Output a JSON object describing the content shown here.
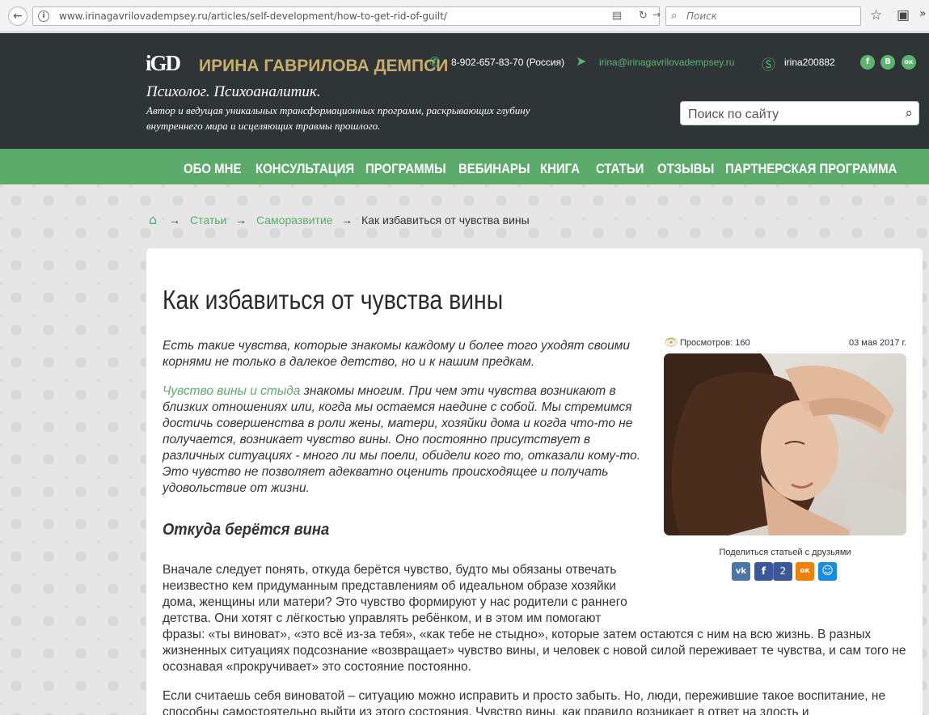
{
  "browser": {
    "back_icon": "back-arrow-icon",
    "url": "www.irinagavrilovadempsey.ru/articles/self-development/how-to-get-rid-of-guilt/",
    "search_placeholder": "Поиск"
  },
  "site": {
    "logo_mark": "iGD",
    "name": "ИРИНА ГАВРИЛОВА ДЕМПСИ",
    "tagline": "Психолог. Психоаналитик.",
    "description": "Автор и ведущая уникальных трансформационных программ, раскрывающих глубину внутреннего мира и исцеляющих травмы прошлого.",
    "phone": "8-902-657-83-70 (Россия)",
    "email": "irina@irinagavrilovadempsey.ru",
    "skype": "irina200882",
    "social": [
      {
        "icon": "facebook-icon",
        "glyph": "f"
      },
      {
        "icon": "vk-icon",
        "glyph": "В"
      },
      {
        "icon": "odnoklassniki-icon",
        "glyph": "ок"
      }
    ],
    "search_placeholder": "Поиск по сайту",
    "colors": {
      "header": "#2f3537",
      "accent": "#5cab6b",
      "gold": "#c9ad6a"
    }
  },
  "nav": [
    "ОБО МНЕ",
    "КОНСУЛЬТАЦИЯ",
    "ПРОГРАММЫ",
    "ВЕБИНАРЫ",
    "КНИГА",
    "СТАТЬИ",
    "ОТЗЫВЫ",
    "ПАРТНЕРСКАЯ ПРОГРАММА"
  ],
  "breadcrumb": {
    "sep": "→",
    "items": [
      "Статьи",
      "Саморазвитие"
    ],
    "current": "Как избавиться от чувства вины"
  },
  "article": {
    "title": "Как избавиться от чувства вины",
    "intro": "Есть такие чувства, которые знакомы каждому и более того уходят своими корнями не только в далекое детство, но и к нашим предкам.",
    "p2_link": "Чувство вины и стыда",
    "p2_text": " знакомы многим. При чем эти чувства возникают в близких отношениях или, когда мы остаемся наедине с собой. Мы стремимся достичь совершенства в роли жены, матери, хозяйки дома и когда что-то не получается, возникает чувство вины. Оно постоянно присутствует в различных ситуациях - много ли мы поели, обидели кого то, отказали кому-то. Это чувство не позволяет адекватно оценить происходящее и получать удовольствие от жизни.",
    "heading": "Откуда берётся вина",
    "p3a": "Вначале следует понять, откуда берётся чувство, будто мы обязаны отвечать неизвестно кем придуманным представлениям об идеальном образе хозяйки дома, женщины или матери? Это чувство формируют у нас родители с раннего детства. Они хотят с лёгкостью управлять ребёнком, и в этом им помогают",
    "p3b": "фразы: «ты виноват», «это всё из-за тебя», «как тебе не стыдно», которые затем остаются с ним на всю жизнь. В разных жизненных ситуациях подсознание «возвращает» чувство вины, и человек с новой силой переживает те чувства, и сам того не осознавая «прокручивает» это состояние  постоянно.",
    "p4": "Если считаешь себя виноватой – ситуацию можно исправить и просто забыть. Но, люди, пережившие такое воспитание, не способны самостоятельно выйти из этого состояния. Чувство вины, как правило возникает в ответ на злость и",
    "views_label": "Просмотров: 160",
    "date": "03 мая 2017 г.",
    "share_label": "Поделиться статьей с друзьями",
    "share_buttons": [
      {
        "icon": "vk-share-icon",
        "glyph": "vk",
        "color": "#4a76a8"
      },
      {
        "icon": "facebook-share-icon",
        "glyph": "f",
        "color": "#3b5998"
      },
      {
        "icon": "odnoklassniki-share-icon",
        "glyph": "ок",
        "color": "#ee8208"
      },
      {
        "icon": "moimir-share-icon",
        "glyph": "☺",
        "color": "#168de2"
      }
    ],
    "share_count": "2"
  }
}
